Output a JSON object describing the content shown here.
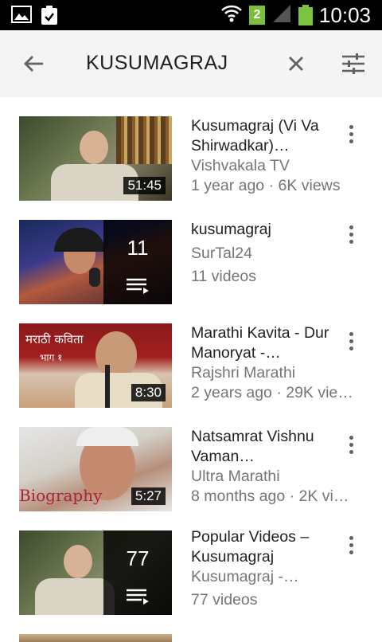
{
  "status_bar": {
    "time": "10:03",
    "sim": "2"
  },
  "search": {
    "query": "KUSUMAGRAJ"
  },
  "results": [
    {
      "title": "Kusumagraj (Vi Va Shirwadkar)…",
      "channel": "Vishvakala TV",
      "meta": "1 year ago · 6K views",
      "duration": "51:45"
    },
    {
      "title": "kusumagraj",
      "channel": "SurTal24",
      "meta": "11 videos",
      "count": "11"
    },
    {
      "title": "Marathi Kavita - Dur Manoryat -…",
      "channel": "Rajshri Marathi",
      "meta": "2 years ago · 29K vie…",
      "duration": "8:30",
      "overlay_text_1": "मराठी कविता",
      "overlay_text_2": "भाग १"
    },
    {
      "title": "Natsamrat Vishnu Vaman…",
      "channel": "Ultra Marathi",
      "meta": "8 months ago · 2K vi…",
      "duration": "5:27",
      "overlay_text": "Biography"
    },
    {
      "title": "Popular Videos – Kusumagraj",
      "channel": "Kusumagraj -…",
      "meta": "77 videos",
      "count": "77"
    }
  ]
}
